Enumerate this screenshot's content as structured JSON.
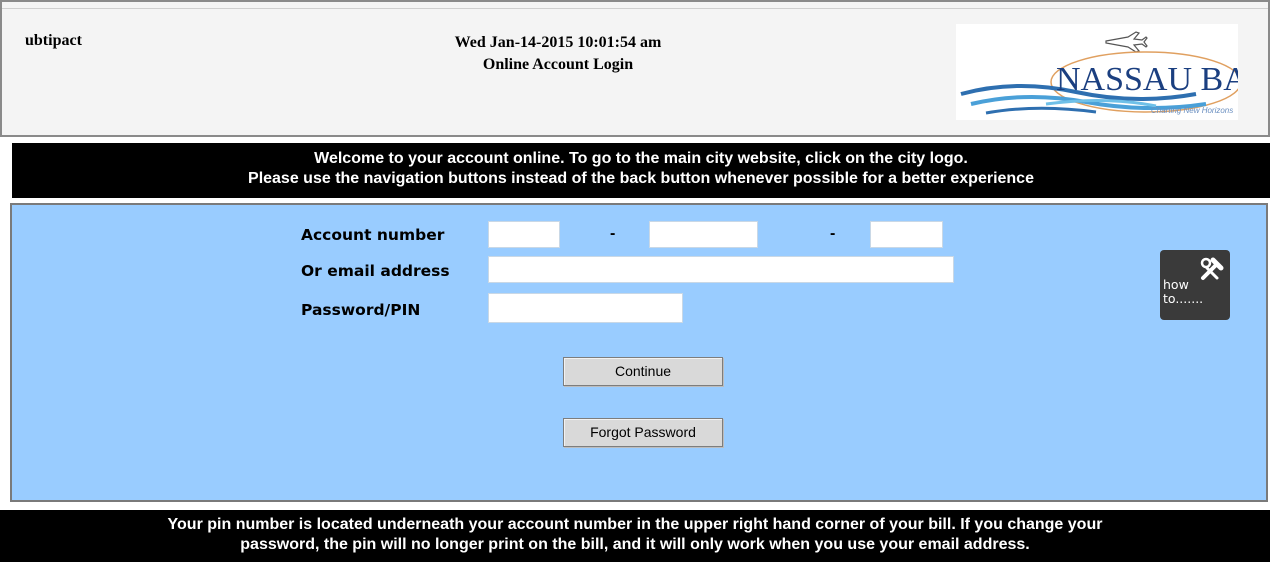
{
  "header": {
    "app_name": "ubtipact",
    "datetime": "Wed Jan-14-2015 10:01:54 am",
    "page_title": "Online Account Login",
    "logo": {
      "text": "NASSAU BAY",
      "tagline": "Charting New Horizons",
      "icon": "airplane-icon"
    }
  },
  "welcome": {
    "line1": "Welcome to your account online. To go to the main city website, click on the city logo.",
    "line2": "Please use the navigation buttons instead of the back button whenever possible for a better experience"
  },
  "form": {
    "account_label": "Account number",
    "dash": "-",
    "email_label": "Or email address",
    "password_label": "Password/PIN",
    "account_part1": "",
    "account_part2": "",
    "account_part3": "",
    "email": "",
    "password": "",
    "continue_label": "Continue",
    "forgot_label": "Forgot Password"
  },
  "howto": {
    "label": "how\nto.......",
    "icon": "tools-icon"
  },
  "footer": {
    "line1": "Your pin number is located underneath your account number in the upper right hand corner of your bill. If you change your",
    "line2": "password, the pin will no longer print on the bill, and it will only work when you use your email address."
  },
  "colors": {
    "panel": "#99ccff",
    "banner": "#000000",
    "header_bg": "#f4f4f4"
  }
}
